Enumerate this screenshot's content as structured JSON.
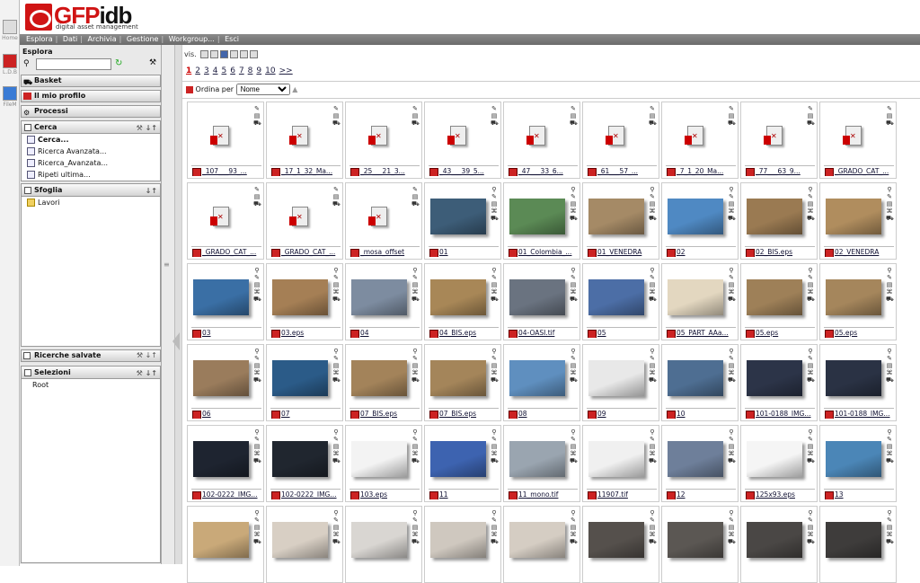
{
  "rail": [
    "Home",
    "L.D.B",
    "FileM"
  ],
  "logo": {
    "text": "GFP",
    "brand": "idb",
    "subtitle": "digital asset management"
  },
  "menu": [
    "Esplora",
    "Dati",
    "Archivia",
    "Gestione",
    "Workgroup...",
    "Esci"
  ],
  "left": {
    "title": "Esplora",
    "basket": "Basket",
    "profile": "Il mio profilo",
    "processes": "Processi",
    "search_panel": {
      "title": "Cerca",
      "items": [
        "Cerca...",
        "Ricerca Avanzata...",
        "Ricerca_Avanzata...",
        "Ripeti ultima..."
      ]
    },
    "browse_panel": {
      "title": "Sfoglia",
      "items": [
        "Lavori"
      ]
    },
    "saved_searches": "Ricerche salvate",
    "selections_panel": {
      "title": "Selezioni",
      "items": [
        "Root"
      ]
    }
  },
  "toolbar": {
    "vis_label": "vis."
  },
  "pager": {
    "pages": [
      "1",
      "2",
      "3",
      "4",
      "5",
      "6",
      "7",
      "8",
      "9",
      "10",
      ">>"
    ],
    "current": "1"
  },
  "sort": {
    "label": "Ordina per",
    "value": "Nome"
  },
  "tiles": [
    {
      "name": "_107___93_...",
      "kind": "doc"
    },
    {
      "name": "_17_1_32_Ma...",
      "kind": "doc"
    },
    {
      "name": "_25___21_3...",
      "kind": "doc"
    },
    {
      "name": "_43___39_5...",
      "kind": "doc"
    },
    {
      "name": "_47___33_6...",
      "kind": "doc"
    },
    {
      "name": "_61___57_...",
      "kind": "doc"
    },
    {
      "name": "_7_1_20_Ma...",
      "kind": "doc"
    },
    {
      "name": "_77___63_9...",
      "kind": "doc"
    },
    {
      "name": "_GRADO_CAT_...",
      "kind": "doc"
    },
    {
      "name": "_GRADO_CAT_...",
      "kind": "doc"
    },
    {
      "name": "_GRADO_CAT_...",
      "kind": "doc"
    },
    {
      "name": "_mosa_offset",
      "kind": "doc"
    },
    {
      "name": "01",
      "kind": "img",
      "color": "#3d5d78"
    },
    {
      "name": "01_Colombia_...",
      "kind": "img",
      "color": "#5b8a55"
    },
    {
      "name": "01_VENEDRA",
      "kind": "img",
      "color": "#a58a66"
    },
    {
      "name": "02",
      "kind": "img",
      "color": "#4f89c3"
    },
    {
      "name": "02_BIS.eps",
      "kind": "img",
      "color": "#9a7a52"
    },
    {
      "name": "02_VENEDRA",
      "kind": "img",
      "color": "#b08d5e"
    },
    {
      "name": "03",
      "kind": "img",
      "color": "#3a6fa5"
    },
    {
      "name": "03.eps",
      "kind": "img",
      "color": "#a57f55"
    },
    {
      "name": "04",
      "kind": "img",
      "color": "#7d8ca0"
    },
    {
      "name": "04_BIS.eps",
      "kind": "img",
      "color": "#a88757"
    },
    {
      "name": "04-OASI.tif",
      "kind": "img",
      "color": "#6a7380"
    },
    {
      "name": "05",
      "kind": "img",
      "color": "#4c6ea6"
    },
    {
      "name": "05_PART_AAa...",
      "kind": "img",
      "color": "#e3d7c0"
    },
    {
      "name": "05.eps",
      "kind": "img",
      "color": "#9e8058"
    },
    {
      "name": "05.eps",
      "kind": "img",
      "color": "#a5865c"
    },
    {
      "name": "06",
      "kind": "img",
      "color": "#9a7c5c"
    },
    {
      "name": "07",
      "kind": "img",
      "color": "#2b5b88"
    },
    {
      "name": "07_BIS.eps",
      "kind": "img",
      "color": "#a3835a"
    },
    {
      "name": "07_BIS.eps",
      "kind": "img",
      "color": "#a4855a"
    },
    {
      "name": "08",
      "kind": "img",
      "color": "#5f8fbf"
    },
    {
      "name": "09",
      "kind": "img",
      "color": "#e8e8e8"
    },
    {
      "name": "10",
      "kind": "img",
      "color": "#4e6e92"
    },
    {
      "name": "101-0188_IMG...",
      "kind": "img",
      "color": "#2c3448"
    },
    {
      "name": "101-0188_IMG...",
      "kind": "img",
      "color": "#2a3244"
    },
    {
      "name": "102-0222_IMG...",
      "kind": "img",
      "color": "#1e2430"
    },
    {
      "name": "102-0222_IMG...",
      "kind": "img",
      "color": "#20262f"
    },
    {
      "name": "103.eps",
      "kind": "img",
      "color": "#f3f3f3"
    },
    {
      "name": "11",
      "kind": "img",
      "color": "#3d63b0"
    },
    {
      "name": "11_mono.tif",
      "kind": "img",
      "color": "#9aa5b0"
    },
    {
      "name": "11907.tif",
      "kind": "img",
      "color": "#f0f0f0"
    },
    {
      "name": "12",
      "kind": "img",
      "color": "#6e7f9a"
    },
    {
      "name": "125x93.eps",
      "kind": "img",
      "color": "#f5f5f5"
    },
    {
      "name": "13",
      "kind": "img",
      "color": "#4b86b7"
    },
    {
      "name": "",
      "kind": "img",
      "color": "#c9a979"
    },
    {
      "name": "",
      "kind": "img",
      "color": "#d8cfc4"
    },
    {
      "name": "",
      "kind": "img",
      "color": "#d9d6d2"
    },
    {
      "name": "",
      "kind": "img",
      "color": "#cfc8bf"
    },
    {
      "name": "",
      "kind": "img",
      "color": "#d5cdc3"
    },
    {
      "name": "",
      "kind": "img",
      "color": "#55504c"
    },
    {
      "name": "",
      "kind": "img",
      "color": "#5b5753"
    },
    {
      "name": "",
      "kind": "img",
      "color": "#4a4745"
    },
    {
      "name": "",
      "kind": "img",
      "color": "#3e3c3b"
    }
  ]
}
